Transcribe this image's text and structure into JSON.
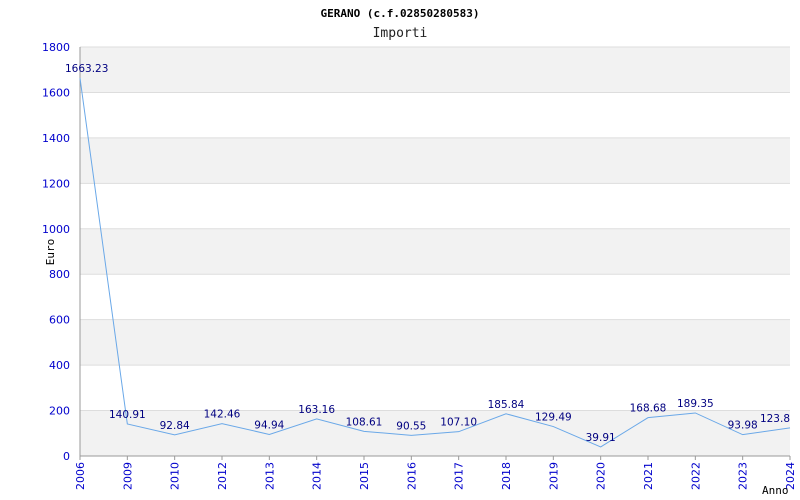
{
  "chart_data": {
    "type": "line",
    "title": "GERANO (c.f.02850280583)",
    "subtitle": "Importi",
    "ylabel": "Euro",
    "xlabel": "Anno",
    "ylim": [
      0,
      1800
    ],
    "yticks": [
      "0",
      "200",
      "400",
      "600",
      "800",
      "1000",
      "1200",
      "1400",
      "1600",
      "1800"
    ],
    "grid": "horizontal bands",
    "categories": [
      "2006",
      "2009",
      "2010",
      "2012",
      "2013",
      "2014",
      "2015",
      "2016",
      "2017",
      "2018",
      "2019",
      "2020",
      "2021",
      "2022",
      "2023",
      "2024"
    ],
    "values": [
      1663.23,
      140.91,
      92.84,
      142.46,
      94.94,
      163.16,
      108.61,
      90.55,
      107.1,
      185.84,
      129.49,
      39.91,
      168.68,
      189.35,
      93.98,
      123.8
    ],
    "value_labels": [
      "1663.23",
      "140.91",
      "92.84",
      "142.46",
      "94.94",
      "163.16",
      "108.61",
      "90.55",
      "107.10",
      "185.84",
      "129.49",
      "39.91",
      "168.68",
      "189.35",
      "93.98",
      "123.8"
    ],
    "line_color": "#6aa8e8",
    "band_color": "#f2f2f2",
    "grid_color": "#dddddd",
    "tick_color": "#0000cc",
    "label_color": "#000080"
  }
}
